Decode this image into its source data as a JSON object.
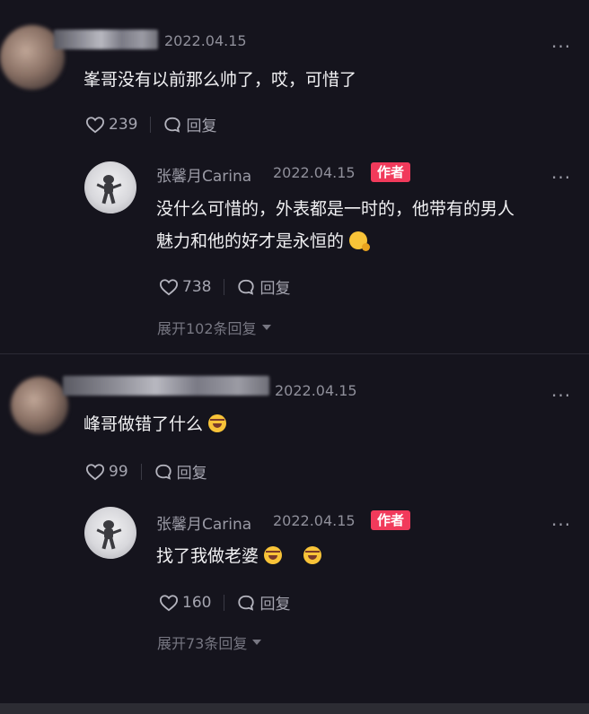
{
  "comments": [
    {
      "date": "2022.04.15",
      "text": "峯哥没有以前那么帅了，哎，可惜了",
      "likes": "239",
      "reply_label": "回复",
      "more": "···",
      "reply": {
        "name": "张馨月Carina",
        "date": "2022.04.15",
        "badge": "作者",
        "line1": "没什么可惜的，外表都是一时的，他带有的男人",
        "line2": "魅力和他的好才是永恒的",
        "likes": "738",
        "reply_label": "回复",
        "expand": "展开102条回复",
        "more": "···"
      }
    },
    {
      "date": "2022.04.15",
      "text": "峰哥做错了什么",
      "likes": "99",
      "reply_label": "回复",
      "more": "···",
      "reply": {
        "name": "张馨月Carina",
        "date": "2022.04.15",
        "badge": "作者",
        "line1": "找了我做老婆",
        "likes": "160",
        "reply_label": "回复",
        "expand": "展开73条回复",
        "more": "···"
      }
    }
  ],
  "icons": {
    "like": "heart-outline-icon",
    "reply": "speech-bubble-icon",
    "more": "ellipsis-icon",
    "expand": "caret-down-icon"
  }
}
